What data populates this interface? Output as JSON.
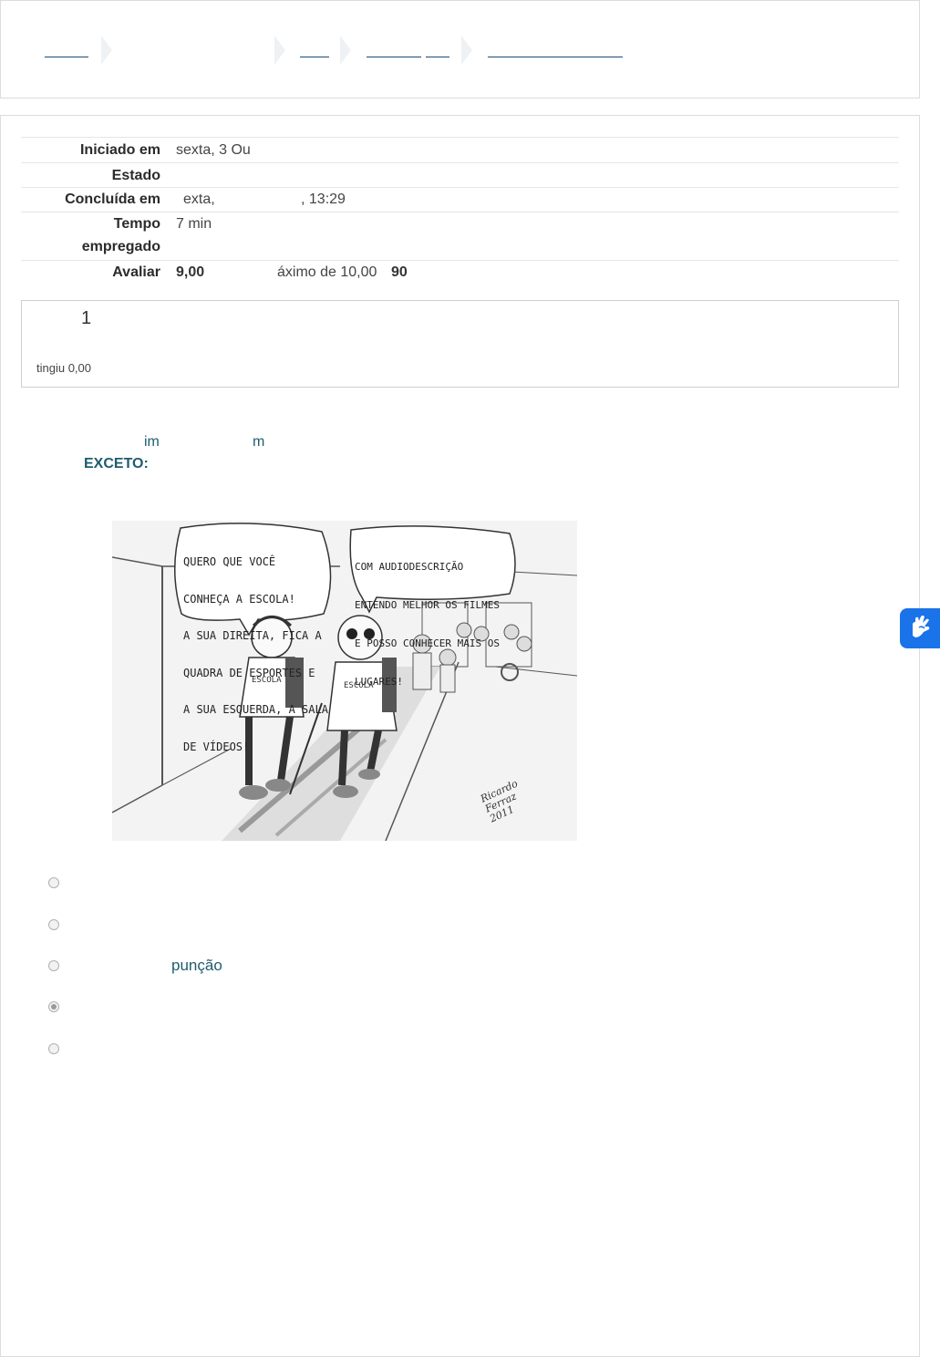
{
  "breadcrumb": {
    "items": [
      "",
      "",
      "",
      "",
      ""
    ]
  },
  "summary": {
    "started_label": "Iniciado em",
    "started_value": "sexta, 3 Ou",
    "state_label": "Estado",
    "state_value": "",
    "completed_label": "Concluída em",
    "completed_value_a": "exta,",
    "completed_value_b": ", 13:29",
    "time_label_1": "Tempo",
    "time_label_2": "empregado",
    "time_value": "7 min",
    "grade_label": "Avaliar",
    "grade_value": "9,00",
    "grade_max": "áximo de 10,00",
    "grade_percent": "90"
  },
  "question_info": {
    "number": "1",
    "grade_text": "tingiu 0,00"
  },
  "question": {
    "text_fragment_1": "im",
    "text_fragment_2": "m",
    "except_label": "EXCETO:",
    "image_alt": "Cartoon: two students walking in a school corridor",
    "bubble_left": [
      "QUERO QUE VOCÊ",
      "CONHEÇA A ESCOLA!",
      "A SUA DIREITA, FICA A",
      "QUADRA DE ESPORTES E",
      "A SUA ESQUERDA, A SALA",
      "DE VÍDEOS!"
    ],
    "bubble_right": [
      "COM AUDIODESCRIÇÃO",
      "ENTENDO MELHOR OS FILMES",
      "E POSSO CONHECER MAIS OS",
      "LUGARES!"
    ],
    "shirt_label": "ESCOLA",
    "signature": [
      "Ricardo",
      "Ferraz",
      "2011"
    ]
  },
  "options": [
    {
      "text": "",
      "checked": false
    },
    {
      "text": "",
      "checked": false
    },
    {
      "text": "punção",
      "checked": false
    },
    {
      "text": "",
      "checked": true
    },
    {
      "text": "",
      "checked": false
    }
  ],
  "accessibility_widget": {
    "icon": "sign-language-hand-icon",
    "color": "#1a73e8"
  }
}
